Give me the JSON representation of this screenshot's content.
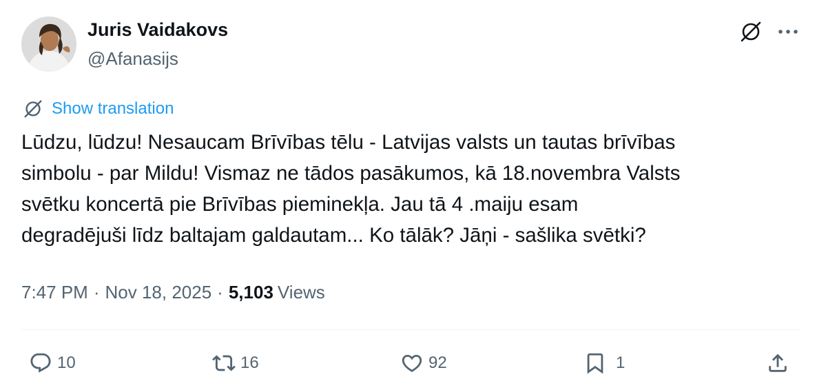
{
  "author": {
    "display_name": "Juris Vaidakovs",
    "handle": "@Afanasijs"
  },
  "translation": {
    "label": "Show translation"
  },
  "tweet": {
    "text": "Lūdzu, lūdzu! Nesaucam Brīvības tēlu - Latvijas valsts un tautas brīvības\nsimbolu - par Mildu! Vismaz ne tādos pasākumos, kā 18.novembra Valsts\nsvētku koncertā pie Brīvības pieminekļa. Jau tā 4 .maiju esam\ndegradējuši līdz baltajam galdautam... Ko tālāk? Jāņi - sašlika svētki?",
    "time": "7:47 PM",
    "separator": "·",
    "date": "Nov 18, 2025",
    "views_count": "5,103",
    "views_label": "Views"
  },
  "actions": {
    "replies": "10",
    "reposts": "16",
    "likes": "92",
    "bookmarks": "1"
  },
  "icons": {
    "grok": "grok-icon",
    "more": "more-icon",
    "translate": "translate-icon",
    "reply": "reply-icon",
    "repost": "repost-icon",
    "like": "heart-icon",
    "bookmark": "bookmark-icon",
    "share": "share-icon"
  },
  "colors": {
    "text": "#0f1419",
    "secondary": "#536471",
    "link": "#1d9bf0",
    "divider": "#eff3f4"
  }
}
